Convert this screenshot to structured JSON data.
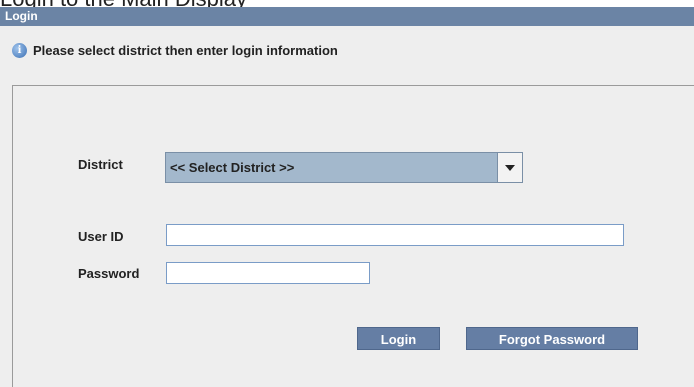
{
  "window": {
    "title": "Login",
    "cut_text": "Login to the Main Display"
  },
  "info": {
    "icon": "info-icon",
    "message": "Please select district then enter login information"
  },
  "form": {
    "district_label": "District",
    "district_value": "<< Select District >>",
    "userid_label": "User ID",
    "userid_value": "",
    "password_label": "Password",
    "password_value": ""
  },
  "buttons": {
    "login_label": "Login",
    "forgot_label": "Forgot Password"
  },
  "colors": {
    "titlebar": "#6b84a5",
    "button": "#657ea4",
    "select": "#a3b8cc",
    "background": "#eeeeee"
  }
}
